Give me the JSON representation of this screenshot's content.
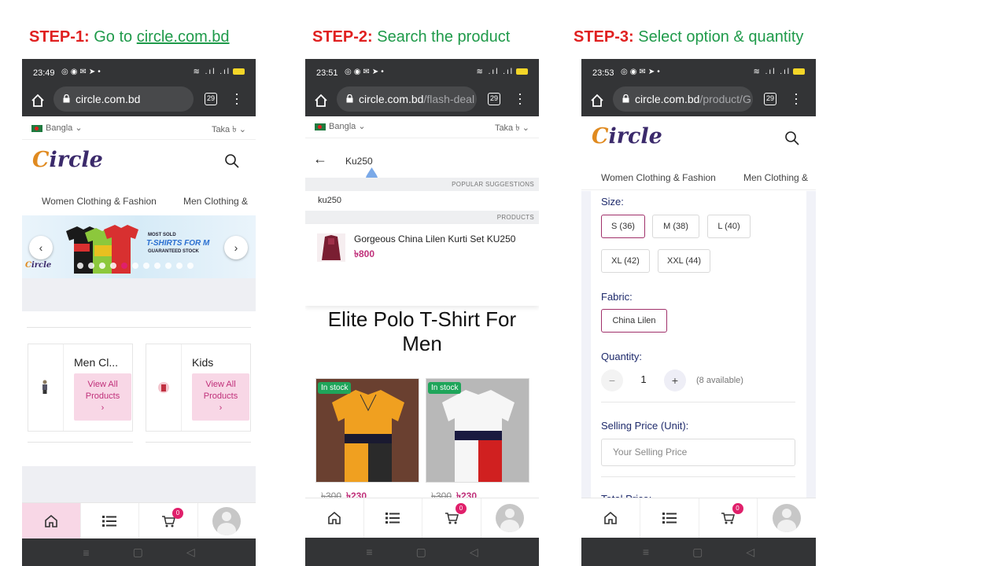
{
  "steps": [
    {
      "prefix": "STEP-1:",
      "text": "Go to ",
      "link": "circle.com.bd"
    },
    {
      "prefix": "STEP-2:",
      "text": "Search the product"
    },
    {
      "prefix": "STEP-3:",
      "text": "Select option & quantity"
    }
  ],
  "phone1": {
    "time": "23:49",
    "url": "circle.com.bd",
    "url_path": "",
    "tabs_count": "29",
    "language": "Bangla",
    "currency": "Taka ৳",
    "logo": "Circle",
    "categories": [
      "Women Clothing & Fashion",
      "Men Clothing &"
    ],
    "banner": {
      "line1": "MOST SOLD",
      "line2": "T-SHIRTS FOR M",
      "line3": "GUARANTEED STOCK"
    },
    "slider_dots_total": 11,
    "slider_dot_active": 4,
    "cat_cards": [
      {
        "name": "Men Cl...",
        "cta_line1": "View All",
        "cta_line2": "Products",
        "cta_chev": "›"
      },
      {
        "name": "Kids",
        "cta_line1": "View All",
        "cta_line2": "Products",
        "cta_chev": "›"
      }
    ],
    "cart_count": "0"
  },
  "phone2": {
    "time": "23:51",
    "url": "circle.com.bd",
    "url_path": "/flash-deal",
    "tabs_count": "29",
    "language": "Bangla",
    "currency": "Taka ৳",
    "search_value": "Ku250",
    "popular_header": "POPULAR SUGGESTIONS",
    "suggestion": "ku250",
    "products_header": "PRODUCTS",
    "result_name": "Gorgeous China Lilen Kurti Set KU250",
    "result_price": "৳800",
    "deal_title": "Elite Polo T-Shirt For Men",
    "products": [
      {
        "stock": "In stock",
        "old": "৳300",
        "new": "৳230"
      },
      {
        "stock": "In stock",
        "old": "৳300",
        "new": "৳230"
      }
    ],
    "cart_count": "0"
  },
  "phone3": {
    "time": "23:53",
    "url": "circle.com.bd",
    "url_path": "/product/G",
    "tabs_count": "29",
    "logo": "Circle",
    "categories": [
      "Women Clothing & Fashion",
      "Men Clothing &"
    ],
    "size_label": "Size:",
    "sizes": [
      "S (36)",
      "M (38)",
      "L (40)",
      "XL (42)",
      "XXL (44)"
    ],
    "size_selected": "S (36)",
    "fabric_label": "Fabric:",
    "fabrics": [
      "China Lilen"
    ],
    "quantity_label": "Quantity:",
    "quantity_value": "1",
    "minus": "−",
    "plus": "+",
    "available": "(8 available)",
    "selling_label": "Selling Price (Unit):",
    "selling_placeholder": "Your Selling Price",
    "total_label": "Total Price:",
    "cart_count": "0"
  }
}
